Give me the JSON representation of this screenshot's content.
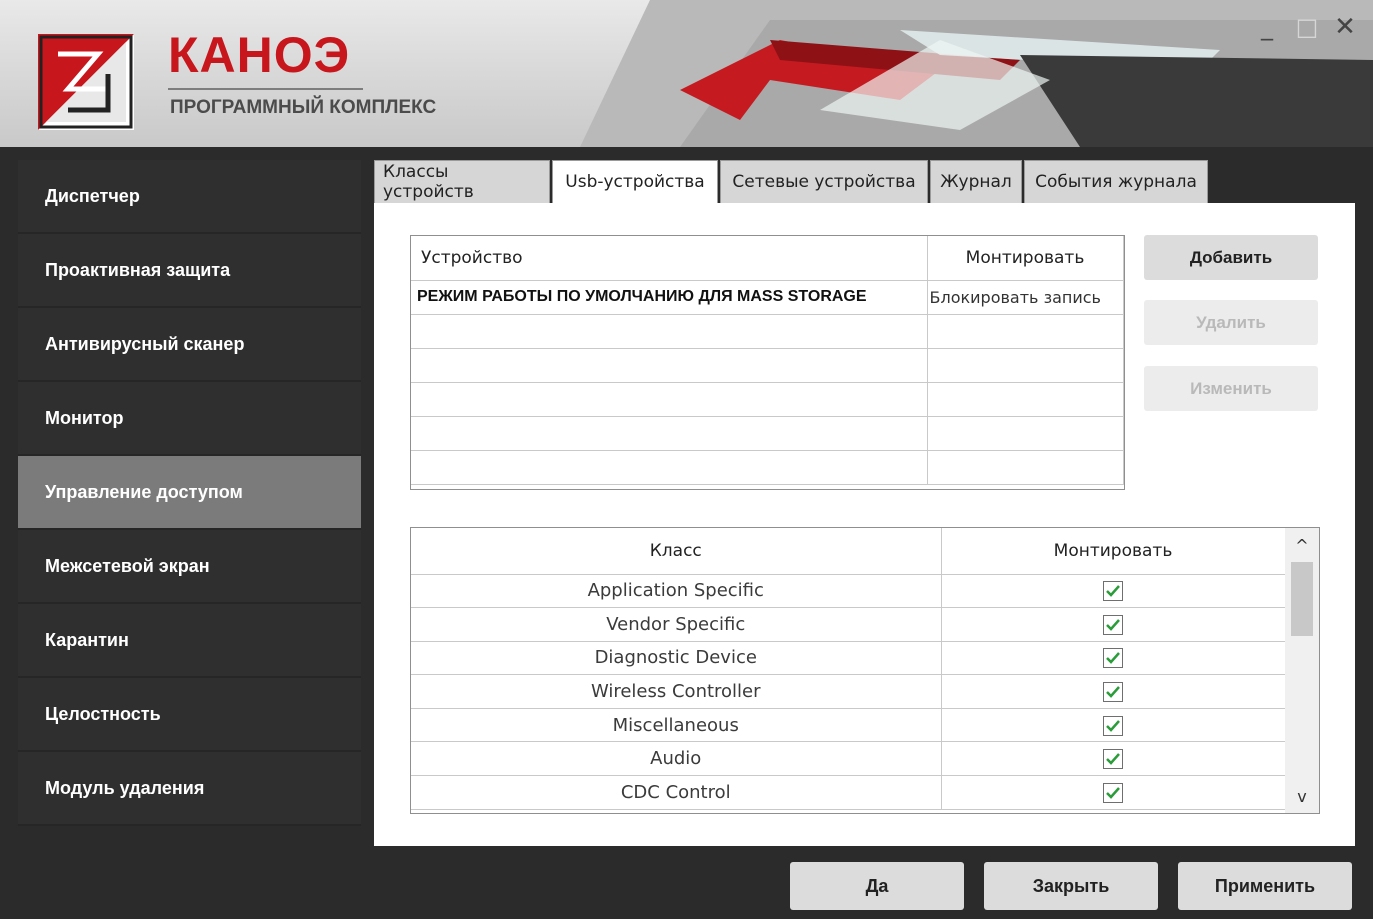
{
  "header": {
    "brand_name": "КАНОЭ",
    "brand_subtitle": "ПРОГРАММНЫЙ КОМПЛЕКС",
    "window_controls": {
      "minimize": "_",
      "maximize": "□",
      "close": "✕"
    }
  },
  "colors": {
    "brand_red": "#c8161d",
    "sidebar_bg": "#2f2f2f",
    "sidebar_active": "#7b7b7b",
    "check_green": "#2a9d3a"
  },
  "sidebar": {
    "items": [
      {
        "label": "Диспетчер"
      },
      {
        "label": "Проактивная защита"
      },
      {
        "label": "Антивирусный сканер"
      },
      {
        "label": "Монитор"
      },
      {
        "label": "Управление доступом",
        "active": true
      },
      {
        "label": "Межсетевой экран"
      },
      {
        "label": "Карантин"
      },
      {
        "label": "Целостность"
      },
      {
        "label": "Модуль удаления"
      }
    ]
  },
  "tabs": [
    {
      "label": "Классы устройств"
    },
    {
      "label": "Usb-устройства",
      "active": true
    },
    {
      "label": "Сетевые устройства"
    },
    {
      "label": "Журнал"
    },
    {
      "label": "События журнала"
    }
  ],
  "devices_table": {
    "headers": [
      "Устройство",
      "Монтировать"
    ],
    "rows": [
      {
        "device": "РЕЖИМ РАБОТЫ ПО УМОЛЧАНИЮ ДЛЯ MASS STORAGE",
        "mount": "Блокировать запись"
      }
    ]
  },
  "side_buttons": {
    "add": "Добавить",
    "delete": "Удалить",
    "edit": "Изменить"
  },
  "classes_table": {
    "headers": [
      "Класс",
      "Монтировать"
    ],
    "rows": [
      {
        "class": "Application Specific",
        "checked": true
      },
      {
        "class": "Vendor Specific",
        "checked": true
      },
      {
        "class": "Diagnostic Device",
        "checked": true
      },
      {
        "class": "Wireless Controller",
        "checked": true
      },
      {
        "class": "Miscellaneous",
        "checked": true
      },
      {
        "class": "Audio",
        "checked": true
      },
      {
        "class": "CDC Control",
        "checked": true
      }
    ]
  },
  "scrollbar": {
    "up": "^",
    "down": "v"
  },
  "bottom_buttons": {
    "yes": "Да",
    "close": "Закрыть",
    "apply": "Применить"
  }
}
